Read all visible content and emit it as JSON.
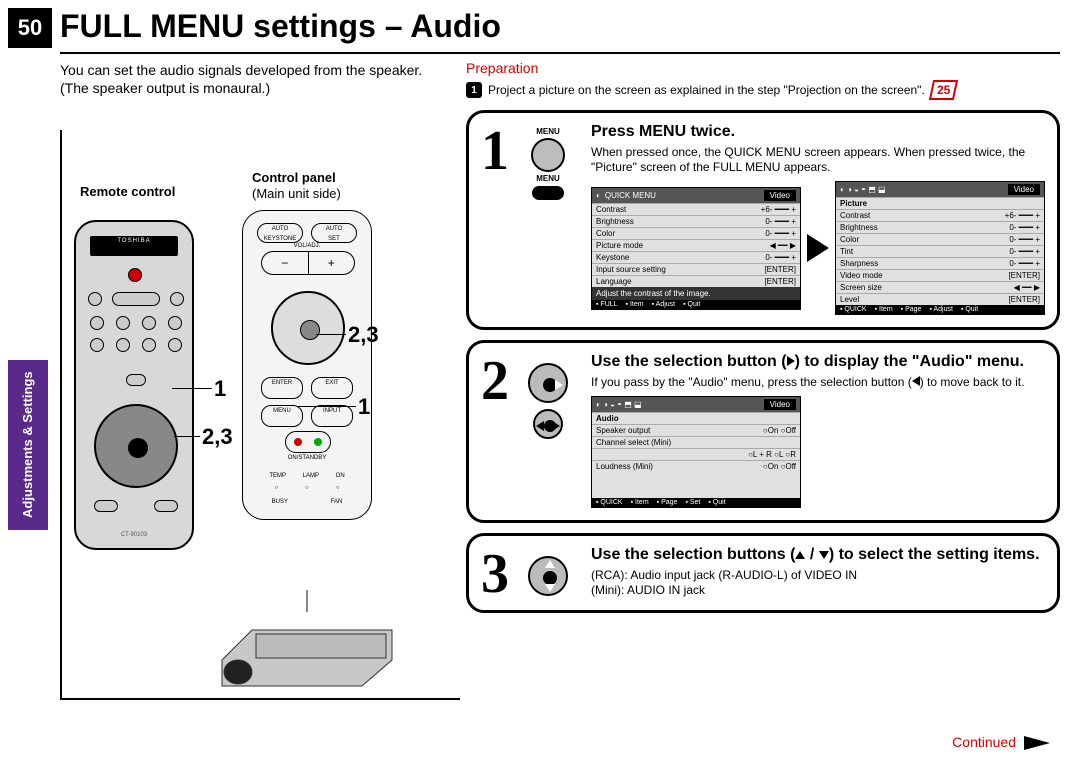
{
  "page_number": "50",
  "title": "FULL MENU settings – Audio",
  "intro": "You can set the audio signals developed from the speaker. (The speaker output is monaural.)",
  "side_tab": "Adjustments &\nSettings",
  "left": {
    "remote_label": "Remote control",
    "panel_label": "Control panel",
    "panel_sub": "(Main unit side)",
    "callout_23_a": "2,3",
    "callout_1_a": "1",
    "callout_23_b": "2,3",
    "callout_1_b": "1",
    "brand": "TOSHIBA",
    "model": "CT-90103"
  },
  "prep": {
    "label": "Preparation",
    "num": "1",
    "text": "Project a picture on the screen as explained in the step \"Projection on the screen\".",
    "ref": "25"
  },
  "steps": [
    {
      "num": "1",
      "icon_top": "MENU",
      "icon_bottom": "MENU",
      "heading": "Press MENU twice.",
      "body": "When pressed once, the QUICK MENU screen appears. When pressed twice, the \"Picture\" screen of the FULL MENU appears."
    },
    {
      "num": "2",
      "heading_pre": "Use the selection button (",
      "heading_post": ") to display the \"Audio\" menu.",
      "body_pre": "If you pass by the \"Audio\" menu, press the selection button (",
      "body_post": ") to move back to it."
    },
    {
      "num": "3",
      "heading_pre": "Use the selection buttons (",
      "heading_mid": " / ",
      "heading_post": ") to select the setting items.",
      "body1": "(RCA): Audio input jack (R-AUDIO-L) of VIDEO IN",
      "body2": "(Mini):  AUDIO IN jack"
    }
  ],
  "osd_quick": {
    "title": "QUICK MENU",
    "tab": "Video",
    "rows": [
      [
        "Contrast",
        "+6",
        "- ━━━ +"
      ],
      [
        "Brightness",
        "0",
        "- ━━━ +"
      ],
      [
        "Color",
        "0",
        "- ━━━ +"
      ],
      [
        "Picture mode",
        "",
        "◀ ━━ ▶"
      ],
      [
        "Keystone",
        "0",
        "- ━━━ +"
      ],
      [
        "Input source setting",
        "",
        "[ENTER]"
      ],
      [
        "Language",
        "",
        "[ENTER]"
      ]
    ],
    "hint": "Adjust the contrast of the image.",
    "foot": [
      "FULL",
      "Item",
      "Adjust",
      "Quit"
    ]
  },
  "osd_full": {
    "tab": "Video",
    "section": "Picture",
    "rows": [
      [
        "Contrast",
        "+6",
        "- ━━━ +"
      ],
      [
        "Brightness",
        "0",
        "- ━━━ +"
      ],
      [
        "Color",
        "0",
        "- ━━━ +"
      ],
      [
        "Tint",
        "0",
        "- ━━━ +"
      ],
      [
        "Sharpness",
        "0",
        "- ━━━ +"
      ],
      [
        "Video mode",
        "",
        "[ENTER]"
      ],
      [
        "Screen size",
        "",
        "◀ ━━ ▶"
      ],
      [
        "Level",
        "",
        "[ENTER]"
      ]
    ],
    "foot": [
      "QUICK",
      "Item",
      "Page",
      "Adjust",
      "Quit"
    ]
  },
  "osd_audio": {
    "tab": "Video",
    "section": "Audio",
    "rows": [
      [
        "Speaker output",
        "○On   ○Off"
      ],
      [
        "Channel select (Mini)",
        ""
      ],
      [
        "",
        "○L + R  ○L   ○R"
      ],
      [
        "Loudness (Mini)",
        "○On   ○Off"
      ]
    ],
    "foot": [
      "QUICK",
      "Item",
      "Page",
      "Set",
      "Quit"
    ]
  },
  "continued": "Continued"
}
